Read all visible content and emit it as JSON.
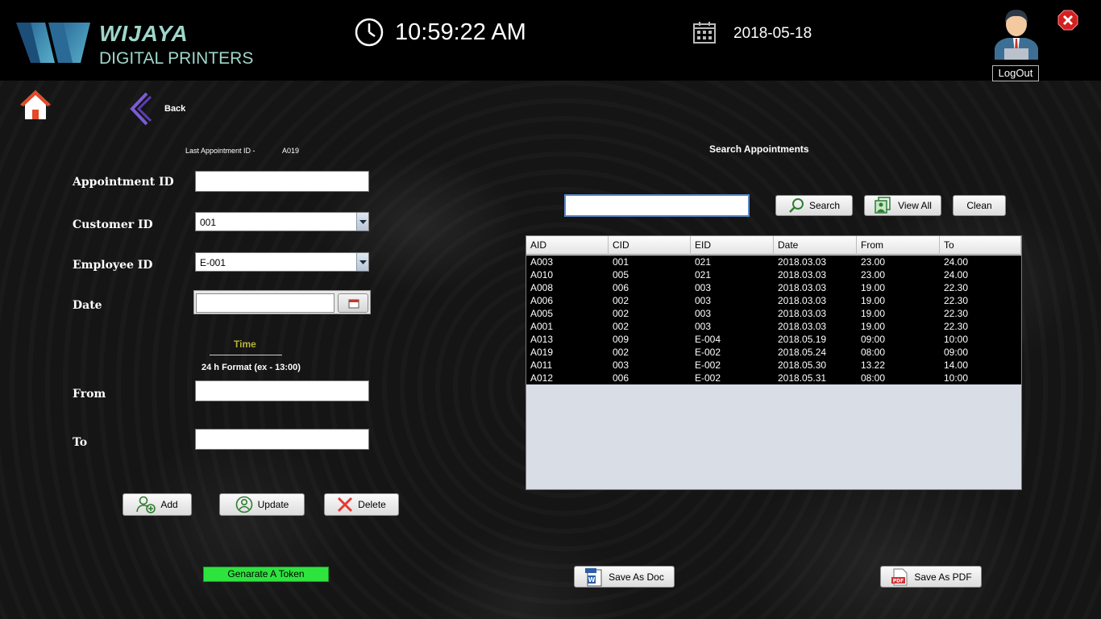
{
  "header": {
    "brand_line1": "WIJAYA",
    "brand_line2": "DIGITAL PRINTERS",
    "time": "10:59:22 AM",
    "date": "2018-05-18",
    "logout_label": "LogOut"
  },
  "nav": {
    "back_label": "Back"
  },
  "form": {
    "last_id_label": "Last Appointment ID -",
    "last_id_value": "A019",
    "appointment_id_label": "Appointment ID",
    "appointment_id_value": "",
    "customer_id_label": "Customer ID",
    "customer_id_value": "001",
    "employee_id_label": "Employee ID",
    "employee_id_value": "E-001",
    "date_label": "Date",
    "date_value": "",
    "time_label": "Time",
    "time_format": "24 h Format (ex - 13:00)",
    "from_label": "From",
    "from_value": "",
    "to_label": "To",
    "to_value": "",
    "add_label": "Add",
    "update_label": "Update",
    "delete_label": "Delete",
    "token_label": "Genarate A Token"
  },
  "search": {
    "title": "Search Appointments",
    "query": "",
    "search_label": "Search",
    "view_all_label": "View All",
    "clean_label": "Clean"
  },
  "table": {
    "columns": [
      "AID",
      "CID",
      "EID",
      "Date",
      "From",
      "To"
    ],
    "rows": [
      [
        "A003",
        "001",
        "021",
        "2018.03.03",
        "23.00",
        "24.00"
      ],
      [
        "A010",
        "005",
        "021",
        "2018.03.03",
        "23.00",
        "24.00"
      ],
      [
        "A008",
        "006",
        "003",
        "2018.03.03",
        "19.00",
        "22.30"
      ],
      [
        "A006",
        "002",
        "003",
        "2018.03.03",
        "19.00",
        "22.30"
      ],
      [
        "A005",
        "002",
        "003",
        "2018.03.03",
        "19.00",
        "22.30"
      ],
      [
        "A001",
        "002",
        "003",
        "2018.03.03",
        "19.00",
        "22.30"
      ],
      [
        "A013",
        "009",
        "E-004",
        "2018.05.19",
        "09:00",
        "10:00"
      ],
      [
        "A019",
        "002",
        "E-002",
        "2018.05.24",
        "08:00",
        "09:00"
      ],
      [
        "A011",
        "003",
        "E-002",
        "2018.05.30",
        "13.22",
        "14.00"
      ],
      [
        "A012",
        "006",
        "E-002",
        "2018.05.31",
        "08:00",
        "10:00"
      ]
    ]
  },
  "export": {
    "doc_label": "Save As Doc",
    "pdf_label": "Save As PDF"
  },
  "colors": {
    "brand": "#9fd6c9",
    "token_button": "#2fe33f",
    "time_label": "#b4b43c",
    "close_red": "#d42020"
  },
  "icons": [
    "logo-w",
    "clock-icon",
    "calendar-icon",
    "user-avatar-icon",
    "close-icon",
    "home-icon",
    "back-arrow-icon",
    "calendar-picker-icon",
    "add-user-icon",
    "update-user-icon",
    "delete-x-icon",
    "search-icon",
    "view-all-icon",
    "doc-icon",
    "pdf-icon"
  ]
}
